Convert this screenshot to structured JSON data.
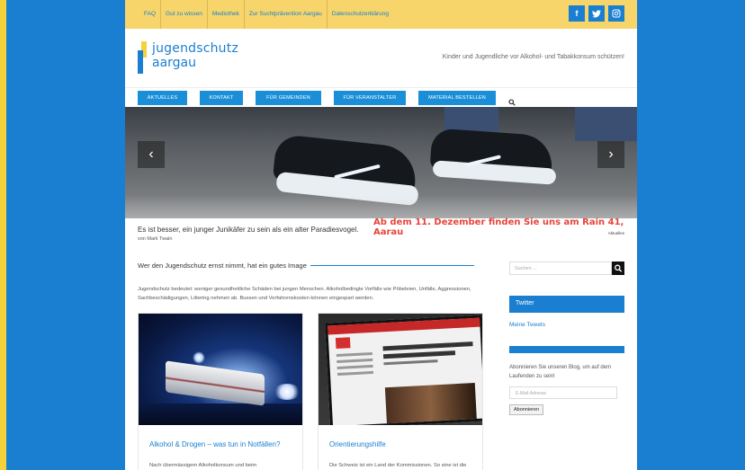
{
  "topbar": {
    "links": [
      "FAQ",
      "Gut zu wissen",
      "Mediothek",
      "Zur Suchtprävention Aargau",
      "Datenschutzerklärung"
    ],
    "social": {
      "facebook": "f",
      "twitter": "t",
      "instagram": "◎"
    }
  },
  "header": {
    "logo_line1": "jugendschutz",
    "logo_line2": "aargau",
    "tagline": "Kinder und Jugendliche vor Alkohol- und Tabakkonsum schützen!"
  },
  "nav": {
    "items": [
      "AKTUELLES",
      "KONTAKT",
      "FÜR GEMEINDEN",
      "FÜR VERANSTALTER",
      "MATERIAL BESTELLEN"
    ]
  },
  "slider": {
    "prev": "‹",
    "next": "›"
  },
  "quote": {
    "text": "Es ist besser, ein junger Junikäfer zu sein als ein alter Paradiesvogel.",
    "author": "von Mark Twain",
    "news": "Ab dem 11. Dezember finden Sie uns am Rain 41, Aarau",
    "news_tag": "Aktuelles"
  },
  "main": {
    "title": "Wer den Jugendschutz ernst nimmt, hat ein gutes Image",
    "intro": "Jugendschutz bedeutet: weniger gesundheitliche Schäden bei jungen Menschen. Alkoholbedingte Vorfälle wie Pöbeleien, Unfälle, Aggressionen, Sachbeschädigungen, Littering nehmen ab. Bussen und Verfahrenskosten können eingespart werden.",
    "cards": [
      {
        "title": "Alkohol & Drogen – was tun in Notfällen?",
        "excerpt": "Nach übermässigem Alkoholkonsum und beim"
      },
      {
        "title": "Orientierungshilfe",
        "excerpt": "Die Schweiz ist ein Land der Kommissionen. So eine ist die Eidgenössische Kommission für Alkoholfragen"
      }
    ]
  },
  "sidebar": {
    "search_placeholder": "Suchen ...",
    "twitter_title": "Twitter",
    "tweets_link": "Meine Tweets",
    "subscribe_text": "Abonnieren Sie unseren Blog, um auf dem Laufenden zu sein!",
    "email_placeholder": "E-Mail-Adresse",
    "subscribe_button": "Abonnieren"
  },
  "colors": {
    "brand_blue": "#1a7fd1",
    "brand_yellow": "#f7d56a",
    "news_red": "#e8443a"
  }
}
